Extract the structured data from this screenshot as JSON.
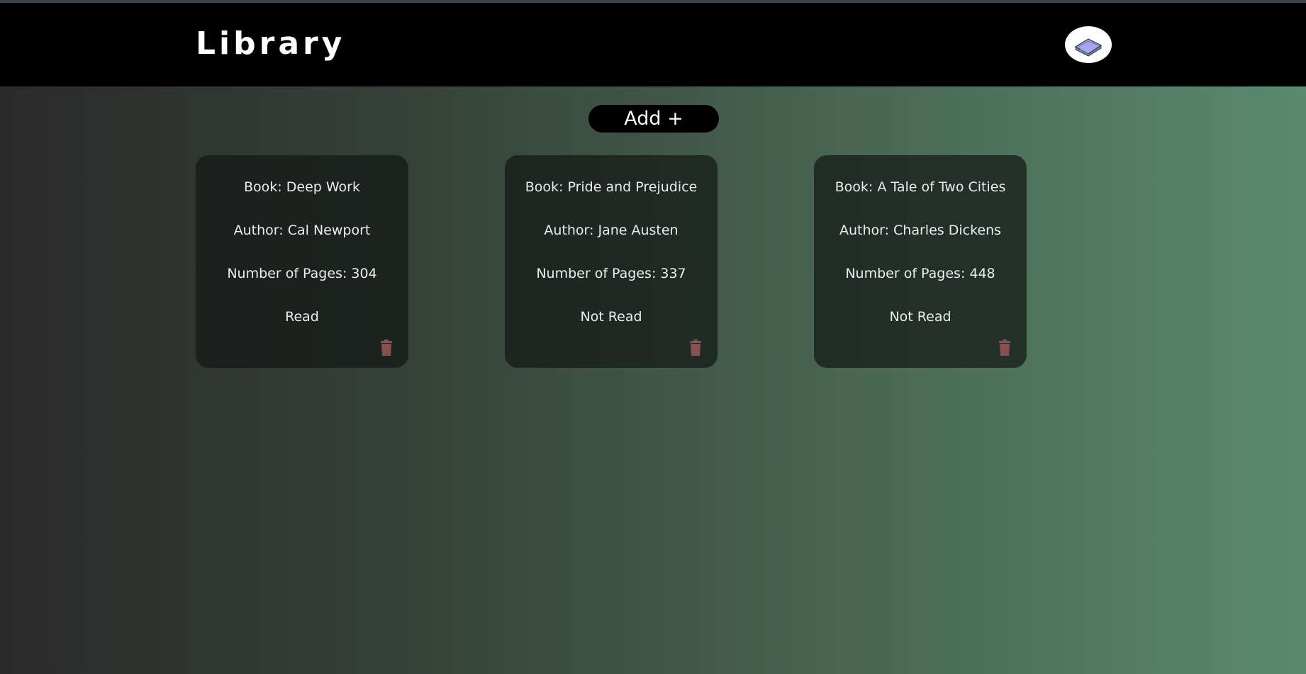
{
  "header": {
    "title": "Library",
    "logo_icon": "book-icon"
  },
  "toolbar": {
    "add_label": "Add +"
  },
  "books": [
    {
      "title": "Book: Deep Work",
      "author": "Author: Cal Newport",
      "pages": "Number of Pages: 304",
      "status": "Read"
    },
    {
      "title": "Book: Pride and Prejudice",
      "author": "Author: Jane Austen",
      "pages": "Number of Pages: 337",
      "status": "Not Read"
    },
    {
      "title": "Book: A Tale of Two Cities",
      "author": "Author: Charles Dickens",
      "pages": "Number of Pages: 448",
      "status": "Not Read"
    }
  ],
  "icons": {
    "delete": "trash-icon"
  },
  "colors": {
    "header_bg": "#000000",
    "trash": "#8a4f4f",
    "card_bg": "#1c211e"
  }
}
